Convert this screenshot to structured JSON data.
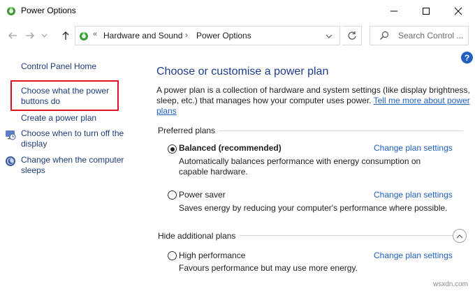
{
  "window": {
    "title": "Power Options"
  },
  "nav": {
    "breadcrumb_root_chevron": "«",
    "breadcrumb": [
      "Hardware and Sound",
      "Power Options"
    ],
    "breadcrumb_separator": "›",
    "search_placeholder": "Search Control ..."
  },
  "help_label": "?",
  "sidebar": {
    "home": "Control Panel Home",
    "items": [
      "Choose what the power buttons do",
      "Create a power plan",
      "Choose when to turn off the display",
      "Change when the computer sleeps"
    ]
  },
  "main": {
    "heading": "Choose or customise a power plan",
    "intro_text": "A power plan is a collection of hardware and system settings (like display brightness, sleep, etc.) that manages how your computer uses power. ",
    "intro_link": "Tell me more about power plans",
    "preferred_label": "Preferred plans",
    "hidden_label": "Hide additional plans",
    "change_link": "Change plan settings",
    "plans": [
      {
        "name": "Balanced (recommended)",
        "desc": "Automatically balances performance with energy consumption on capable hardware.",
        "selected": true
      },
      {
        "name": "Power saver",
        "desc": "Saves energy by reducing your computer's performance where possible.",
        "selected": false
      },
      {
        "name": "High performance",
        "desc": "Favours performance but may use more energy.",
        "selected": false
      }
    ]
  },
  "watermark": "wsxdn.com",
  "colors": {
    "link": "#1f5fbf",
    "heading": "#1e3c8c",
    "highlight": "#e01020"
  }
}
